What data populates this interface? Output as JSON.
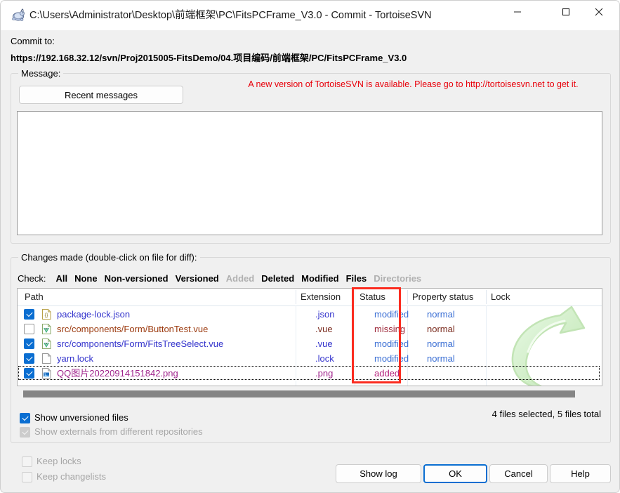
{
  "window": {
    "title": "C:\\Users\\Administrator\\Desktop\\前端框架\\PC\\FitsPCFrame_V3.0 - Commit - TortoiseSVN",
    "icon": "tortoisesvn-turtle-icon",
    "minimize_label": "–",
    "maximize_label": "□",
    "close_label": "✕"
  },
  "commit_to": {
    "label": "Commit to:",
    "url": "https://192.168.32.12/svn/Proj2015005-FitsDemo/04.项目编码/前端框架/PC/FitsPCFrame_V3.0"
  },
  "message_group": {
    "title": "Message:",
    "recent_messages_label": "Recent messages",
    "new_version_notice": "A new version of TortoiseSVN is available. Please go to http://tortoisesvn.net to get it.",
    "notice_color": "#e8000a",
    "message_value": "",
    "message_placeholder": ""
  },
  "changes_group": {
    "title": "Changes made (double-click on file for diff):",
    "check_bar": {
      "label": "Check:",
      "links": [
        {
          "label": "All",
          "enabled": true
        },
        {
          "label": "None",
          "enabled": true
        },
        {
          "label": "Non-versioned",
          "enabled": true
        },
        {
          "label": "Versioned",
          "enabled": true
        },
        {
          "label": "Added",
          "enabled": false
        },
        {
          "label": "Deleted",
          "enabled": true
        },
        {
          "label": "Modified",
          "enabled": true
        },
        {
          "label": "Files",
          "enabled": true
        },
        {
          "label": "Directories",
          "enabled": false
        }
      ]
    },
    "columns": [
      {
        "key": "path",
        "label": "Path"
      },
      {
        "key": "extension",
        "label": "Extension"
      },
      {
        "key": "status",
        "label": "Status"
      },
      {
        "key": "property_status",
        "label": "Property status"
      },
      {
        "key": "lock",
        "label": "Lock"
      }
    ],
    "rows": [
      {
        "checked": true,
        "icon": "json-file-icon",
        "path": "package-lock.json",
        "path_color": "#3333cc",
        "extension": ".json",
        "ext_color": "#3333cc",
        "status": "modified",
        "status_color": "#3b6fd4",
        "property_status": "normal",
        "prop_color": "#3b6fd4",
        "lock": "",
        "focused": false
      },
      {
        "checked": false,
        "icon": "vue-file-icon",
        "path": "src/components/Form/ButtonTest.vue",
        "path_color": "#9c3b10",
        "extension": ".vue",
        "ext_color": "#7a2b1e",
        "status": "missing",
        "status_color": "#9b2335",
        "property_status": "normal",
        "prop_color": "#7a2b1e",
        "lock": "",
        "focused": false
      },
      {
        "checked": true,
        "icon": "vue-file-icon",
        "path": "src/components/Form/FitsTreeSelect.vue",
        "path_color": "#3333cc",
        "extension": ".vue",
        "ext_color": "#3333cc",
        "status": "modified",
        "status_color": "#3b6fd4",
        "property_status": "normal",
        "prop_color": "#3b6fd4",
        "lock": "",
        "focused": false
      },
      {
        "checked": true,
        "icon": "blank-file-icon",
        "path": "yarn.lock",
        "path_color": "#3333cc",
        "extension": ".lock",
        "ext_color": "#3333cc",
        "status": "modified",
        "status_color": "#3b6fd4",
        "property_status": "normal",
        "prop_color": "#3b6fd4",
        "lock": "",
        "focused": false
      },
      {
        "checked": true,
        "icon": "image-file-icon",
        "path": "QQ图片20220914151842.png",
        "path_color": "#a0248c",
        "extension": ".png",
        "ext_color": "#a0248c",
        "status": "added",
        "status_color": "#b51f7a",
        "property_status": "",
        "prop_color": "#b51f7a",
        "lock": "",
        "focused": true
      }
    ],
    "watermark_icon": "green-curved-arrow-watermark",
    "watermark_color": "#cdf0c6",
    "scrollbar": {
      "orientation": "horizontal"
    }
  },
  "options": {
    "show_unversioned": {
      "label": "Show unversioned files",
      "checked": true,
      "enabled": true
    },
    "show_externals": {
      "label": "Show externals from different repositories",
      "checked": true,
      "enabled": false
    },
    "keep_locks": {
      "label": "Keep locks",
      "checked": false,
      "enabled": false
    },
    "keep_changelists": {
      "label": "Keep changelists",
      "checked": false,
      "enabled": false
    }
  },
  "status": {
    "files_count": "4 files selected, 5 files total"
  },
  "buttons": {
    "show_log": "Show log",
    "ok": "OK",
    "cancel": "Cancel",
    "help": "Help"
  },
  "annotation": {
    "type": "red-rectangle-highlight",
    "target_column": "Status",
    "color": "#fb2b1f"
  }
}
